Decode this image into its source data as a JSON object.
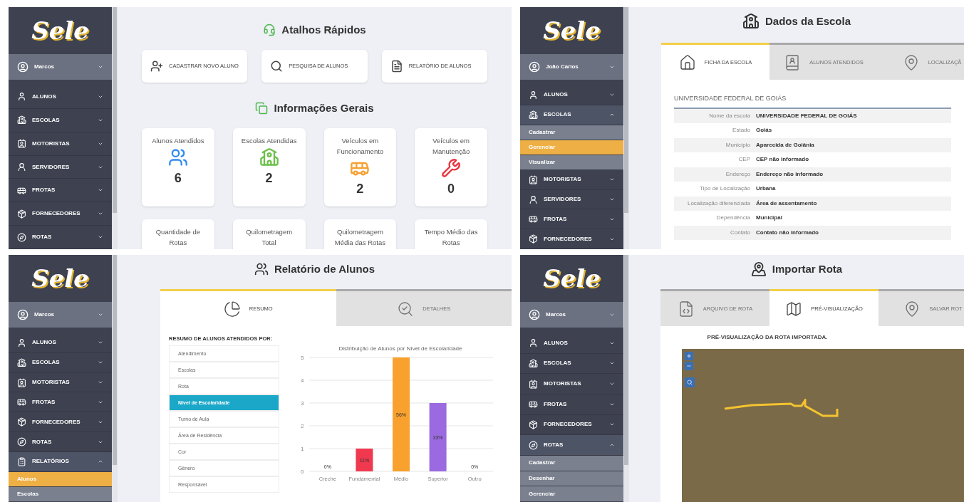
{
  "panels": [
    {
      "kind": "dashboard",
      "sidebar": {
        "logo": "Sele",
        "user": "Marcos",
        "items": [
          {
            "kind": "students",
            "label": "ALUNOS",
            "expanded": false
          },
          {
            "kind": "schools",
            "label": "ESCOLAS",
            "expanded": false
          },
          {
            "kind": "drivers",
            "label": "MOTORISTAS",
            "expanded": false
          },
          {
            "kind": "staff",
            "label": "SERVIDORES",
            "expanded": false
          },
          {
            "kind": "fleet",
            "label": "FROTAS",
            "expanded": false
          },
          {
            "kind": "suppliers",
            "label": "FORNECEDORES",
            "expanded": false
          },
          {
            "kind": "routes",
            "label": "ROTAS",
            "expanded": false
          }
        ]
      },
      "shortcuts_title": "Atalhos Rápidos",
      "shortcuts": [
        {
          "kind": "add",
          "label": "CADASTRAR NOVO ALUNO"
        },
        {
          "kind": "search",
          "label": "PESQUISA DE ALUNOS"
        },
        {
          "kind": "report",
          "label": "RELATÓRIO DE ALUNOS"
        }
      ],
      "info_title": "Informações Gerais",
      "cards": [
        {
          "kind": "students",
          "label": "Alunos Atendidos",
          "value": "6",
          "color": "#2f8cf0"
        },
        {
          "kind": "schools",
          "label": "Escolas Atendidas",
          "value": "2",
          "color": "#6cc04a"
        },
        {
          "kind": "bus",
          "label": "Veículos em Funcionamento",
          "value": "2",
          "color": "#f5a133"
        },
        {
          "kind": "repair",
          "label": "Veículos em Manutenção",
          "value": "0",
          "color": "#e8323c"
        },
        {
          "kind": "none",
          "label": "Quantidade de Rotas"
        },
        {
          "kind": "none",
          "label": "Quilometragem Total"
        },
        {
          "kind": "none",
          "label": "Quilometragem Média das Rotas"
        },
        {
          "kind": "none",
          "label": "Tempo Médio das Rotas"
        }
      ]
    },
    {
      "kind": "school",
      "sidebar": {
        "logo": "Sele",
        "user": "João Carlos",
        "items": [
          {
            "kind": "students",
            "label": "ALUNOS",
            "expanded": false
          },
          {
            "kind": "schools",
            "label": "ESCOLAS",
            "expanded": true,
            "children": [
              {
                "label": "Cadastrar",
                "selected": false
              },
              {
                "label": "Gerenciar",
                "selected": true
              },
              {
                "label": "Visualizar",
                "selected": false
              }
            ]
          },
          {
            "kind": "drivers",
            "label": "MOTORISTAS",
            "expanded": false
          },
          {
            "kind": "staff",
            "label": "SERVIDORES",
            "expanded": false
          },
          {
            "kind": "fleet",
            "label": "FROTAS",
            "expanded": false
          },
          {
            "kind": "suppliers",
            "label": "FORNECEDORES",
            "expanded": false
          }
        ]
      },
      "title": "Dados da Escola",
      "tabs": [
        {
          "kind": "sheet",
          "label": "FICHA DA ESCOLA",
          "selected": true
        },
        {
          "kind": "students",
          "label": "ALUNOS ATENDIDOS",
          "selected": false
        },
        {
          "kind": "location",
          "label": "LOCALIZAÇÃ",
          "selected": false
        }
      ],
      "heading": "UNIVERSIDADE FEDERAL DE GOIÁS",
      "rows": [
        {
          "label": "Nome da escola",
          "value": "UNIVERSIDADE FEDERAL DE GOIÁS"
        },
        {
          "label": "Estado",
          "value": "Goiás"
        },
        {
          "label": "Município",
          "value": "Aparecida de Goiânia"
        },
        {
          "label": "CEP",
          "value": "CEP não informado"
        },
        {
          "label": "Endereço",
          "value": "Endereço não informado"
        },
        {
          "label": "Tipo de Localização",
          "value": "Urbana"
        },
        {
          "label": "Localização diferenciada",
          "value": "Área de assentamento"
        },
        {
          "label": "Dependência",
          "value": "Municipal"
        },
        {
          "label": "Contato",
          "value": "Contato não informado"
        }
      ]
    },
    {
      "kind": "report",
      "sidebar": {
        "logo": "Sele",
        "user": "Marcos",
        "items": [
          {
            "kind": "students",
            "label": "ALUNOS",
            "expanded": false
          },
          {
            "kind": "schools",
            "label": "ESCOLAS",
            "expanded": false
          },
          {
            "kind": "drivers",
            "label": "MOTORISTAS",
            "expanded": false
          },
          {
            "kind": "fleet",
            "label": "FROTAS",
            "expanded": false
          },
          {
            "kind": "suppliers",
            "label": "FORNECEDORES",
            "expanded": false
          },
          {
            "kind": "routes",
            "label": "ROTAS",
            "expanded": false
          },
          {
            "kind": "reports",
            "label": "RELATÓRIOS",
            "expanded": true,
            "children": [
              {
                "label": "Alunos",
                "selected": true
              },
              {
                "label": "Escolas",
                "selected": false
              }
            ]
          }
        ]
      },
      "title": "Relatório de Alunos",
      "tabs": [
        {
          "kind": "summary",
          "label": "RESUMO",
          "selected": true
        },
        {
          "kind": "details",
          "label": "DETALHES",
          "selected": false
        }
      ],
      "list_title": "RESUMO DE ALUNOS ATENDIDOS POR:",
      "options": [
        {
          "label": "Atendimento",
          "selected": false
        },
        {
          "label": "Escolas",
          "selected": false
        },
        {
          "label": "Rota",
          "selected": false
        },
        {
          "label": "Nível de Escolaridade",
          "selected": true
        },
        {
          "label": "Turno de Aula",
          "selected": false
        },
        {
          "label": "Área de Residência",
          "selected": false
        },
        {
          "label": "Cor",
          "selected": false
        },
        {
          "label": "Gênero",
          "selected": false
        },
        {
          "label": "Responsável",
          "selected": false
        }
      ],
      "chart_data": {
        "type": "bar",
        "title": "Distribuição de Alunos por Nível de Escolaridade",
        "categories": [
          "Creche",
          "Fundamental",
          "Médio",
          "Superior",
          "Outro"
        ],
        "series": [
          {
            "colors": [
              null,
              "#f0394f",
              "#f9a12e",
              "#9b6ae0",
              null
            ],
            "values": [
              0,
              1,
              5,
              3,
              0
            ]
          }
        ],
        "grid": true,
        "ylim": [
          0,
          5
        ],
        "yticks": [
          0,
          1,
          2,
          3,
          4,
          5
        ],
        "value_labels": [
          "0%",
          "11%",
          "56%",
          "33%",
          "0%"
        ]
      }
    },
    {
      "kind": "route",
      "sidebar": {
        "logo": "Sele",
        "user": "Marcos",
        "items": [
          {
            "kind": "students",
            "label": "ALUNOS",
            "expanded": false
          },
          {
            "kind": "schools",
            "label": "ESCOLAS",
            "expanded": false
          },
          {
            "kind": "drivers",
            "label": "MOTORISTAS",
            "expanded": false
          },
          {
            "kind": "fleet",
            "label": "FROTAS",
            "expanded": false
          },
          {
            "kind": "suppliers",
            "label": "FORNECEDORES",
            "expanded": false
          },
          {
            "kind": "routes",
            "label": "ROTAS",
            "expanded": true,
            "children": [
              {
                "label": "Cadastrar",
                "selected": false
              },
              {
                "label": "Desenhar",
                "selected": false
              },
              {
                "label": "Gerenciar",
                "selected": false
              }
            ]
          }
        ]
      },
      "title": "Importar Rota",
      "tabs": [
        {
          "kind": "file",
          "label": "ARQUIVO DE ROTA",
          "selected": false
        },
        {
          "kind": "map",
          "label": "PRÉ-VISUALIZAÇÃO",
          "selected": true
        },
        {
          "kind": "save",
          "label": "SALVAR ROT",
          "selected": false
        }
      ],
      "caption": "PRÉ-VISUALIZAÇÃO DA ROTA IMPORTADA."
    }
  ]
}
